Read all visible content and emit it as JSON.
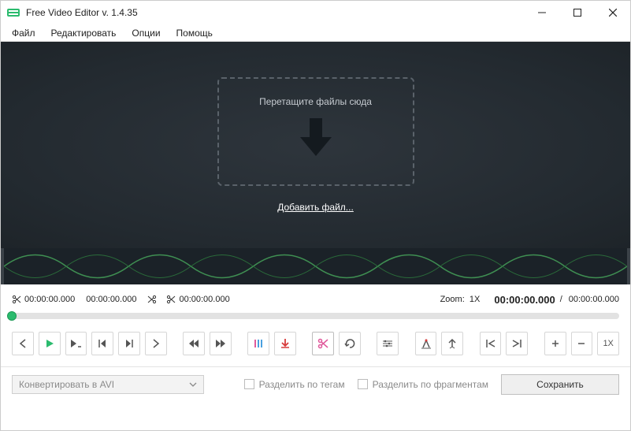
{
  "window": {
    "title": "Free Video Editor v. 1.4.35"
  },
  "menu": {
    "file": "Файл",
    "edit": "Редактировать",
    "options": "Опции",
    "help": "Помощь"
  },
  "preview": {
    "drop_text": "Перетащите файлы сюда",
    "add_file": "Добавить файл..."
  },
  "times": {
    "cut_start": "00:00:00.000",
    "cut_end": "00:00:00.000",
    "sel_time": "00:00:00.000",
    "zoom_label": "Zoom:",
    "zoom_value": "1X",
    "current": "00:00:00.000",
    "sep": "/",
    "total": "00:00:00.000"
  },
  "toolbar": {
    "zoom_reset": "1X"
  },
  "bottom": {
    "convert_label": "Конвертировать в AVI",
    "split_tags": "Разделить по тегам",
    "split_fragments": "Разделить по фрагментам",
    "save": "Сохранить"
  },
  "colors": {
    "accent": "#2bbb6e"
  }
}
